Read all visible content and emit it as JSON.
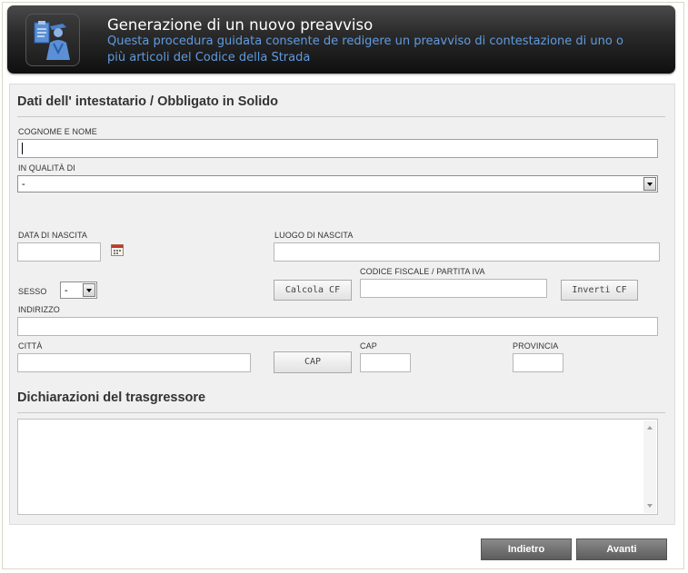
{
  "header": {
    "title": "Generazione di un nuovo preavviso",
    "subtitle": "Questa procedura guidata consente de redigere un preavviso di contestazione di uno o più articoli del Codice della Strada",
    "icon": "police-officer-icon"
  },
  "section1": {
    "title": "Dati dell' intestatario / Obbligato in Solido"
  },
  "fields": {
    "cognome_label": "COGNOME E NOME",
    "cognome_value": "",
    "qualita_label": "IN QUALITÀ DI",
    "qualita_value": "-",
    "data_nascita_label": "DATA DI NASCITA",
    "luogo_nascita_label": "LUOGO DI NASCITA",
    "codice_fiscale_label": "CODICE FISCALE / PARTITA IVA",
    "sesso_label": "SESSO",
    "sesso_value": "-",
    "indirizzo_label": "INDIRIZZO",
    "citta_label": "CITTÀ",
    "cap_label": "CAP",
    "provincia_label": "PROVINCIA"
  },
  "buttons": {
    "calcola_cf": "Calcola CF",
    "inverti_cf": "Inverti CF",
    "cap": "CAP",
    "indietro": "Indietro",
    "avanti": "Avanti"
  },
  "section2": {
    "title": "Dichiarazioni del trasgressore"
  },
  "colors": {
    "header_bg": "#1a1a1a",
    "subtitle": "#5f9be0",
    "panel_bg": "#f0f0f0",
    "nav_button": "#6f6f6f"
  }
}
